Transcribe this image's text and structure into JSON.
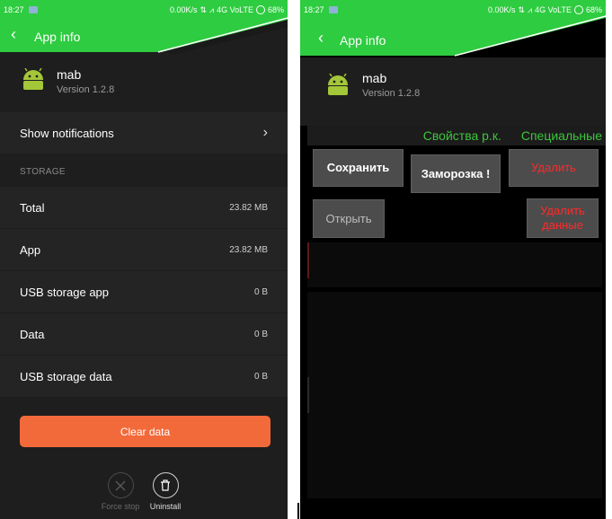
{
  "status_bar": {
    "time": "18:27",
    "speed": "0.00K/s",
    "network": "4G VoLTE",
    "battery": "68%"
  },
  "left": {
    "app_bar_title": "App info",
    "app": {
      "name": "mab",
      "version": "Version 1.2.8"
    },
    "notifications_label": "Show notifications",
    "storage_section": "STORAGE",
    "storage_rows": [
      {
        "label": "Total",
        "value": "23.82 MB"
      },
      {
        "label": "App",
        "value": "23.82 MB"
      },
      {
        "label": "USB storage app",
        "value": "0 B"
      },
      {
        "label": "Data",
        "value": "0 B"
      },
      {
        "label": "USB storage data",
        "value": "0 B"
      }
    ],
    "clear_data_label": "Clear data",
    "force_stop_label": "Force stop",
    "uninstall_label": "Uninstall"
  },
  "right": {
    "app_bar_title": "App info",
    "app": {
      "name": "mab",
      "version": "Version 1.2.8"
    },
    "tabs": [
      "Свойства р.к.",
      "Специальные"
    ],
    "buttons": {
      "save": "Сохранить",
      "freeze": "Заморозка !",
      "delete": "Удалить",
      "open": "Открыть",
      "delete_data": "Удалить данные"
    }
  },
  "colors": {
    "accent_green": "#2ecc40",
    "tab_green": "#3ec53e",
    "clear_orange": "#f36a3a",
    "danger_red": "#ff2a2a"
  }
}
